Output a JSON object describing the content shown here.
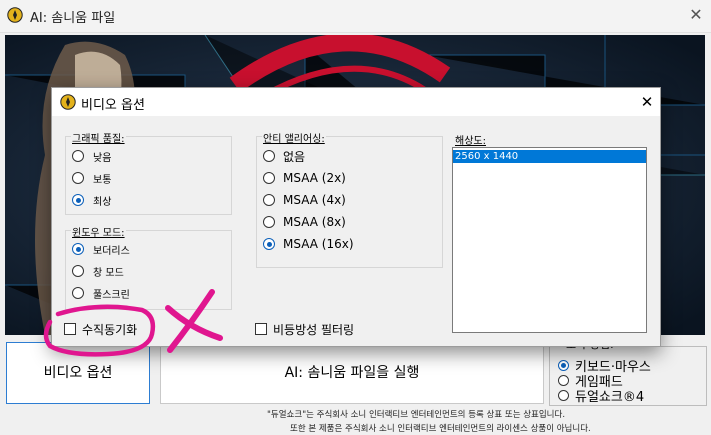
{
  "main_window": {
    "title": "AI: 솜니움 파일",
    "close_glyph": "✕",
    "video_options_label": "비디오 옵션",
    "launch_label": "AI: 솜니움 파일을 실행",
    "controls": {
      "legend": "조작 방법:",
      "options": [
        {
          "label": "키보드·마우스",
          "selected": true
        },
        {
          "label": "게임패드",
          "selected": false
        },
        {
          "label": "듀얼쇼크®4",
          "selected": false
        }
      ]
    },
    "footer": {
      "line1": "\"듀얼쇼크\"는 주식회사 소니 인터랙티브 엔터테인먼트의 등록 상표 또는 상표입니다.",
      "line2": "또한 본 제품은 주식회사 소니 인터랙티브 엔터테인먼트의 라이센스 상품이 아닙니다."
    }
  },
  "dialog": {
    "title": "비디오 옵션",
    "close_glyph": "✕",
    "graphics_quality": {
      "legend": "그래픽 품질:",
      "options": [
        {
          "label": "낮음",
          "selected": false
        },
        {
          "label": "보통",
          "selected": false
        },
        {
          "label": "최상",
          "selected": true
        }
      ]
    },
    "window_mode": {
      "legend": "윈도우 모드:",
      "options": [
        {
          "label": "보더리스",
          "selected": true
        },
        {
          "label": "창 모드",
          "selected": false
        },
        {
          "label": "풀스크린",
          "selected": false
        }
      ]
    },
    "anti_aliasing": {
      "legend": "안티 앨리어싱:",
      "options": [
        {
          "label": "없음",
          "selected": false
        },
        {
          "label": "MSAA (2x)",
          "selected": false
        },
        {
          "label": "MSAA (4x)",
          "selected": false
        },
        {
          "label": "MSAA (8x)",
          "selected": false
        },
        {
          "label": "MSAA (16x)",
          "selected": true
        }
      ]
    },
    "resolution": {
      "legend": "해상도:",
      "items": [
        "2560 x 1440"
      ],
      "selected_index": 0
    },
    "vsync": {
      "label": "수직동기화",
      "checked": false
    },
    "anisotropic": {
      "label": "비등방성 필터링",
      "checked": false
    }
  },
  "colors": {
    "accent": "#0078d7",
    "radio_selected": "#0b5fb9",
    "annotation_magenta": "#e0168f",
    "icon_gold": "#e3b21c"
  },
  "annotations": {
    "circle_icon": "magenta-circle-annotation",
    "cross_icon": "magenta-x-annotation"
  }
}
